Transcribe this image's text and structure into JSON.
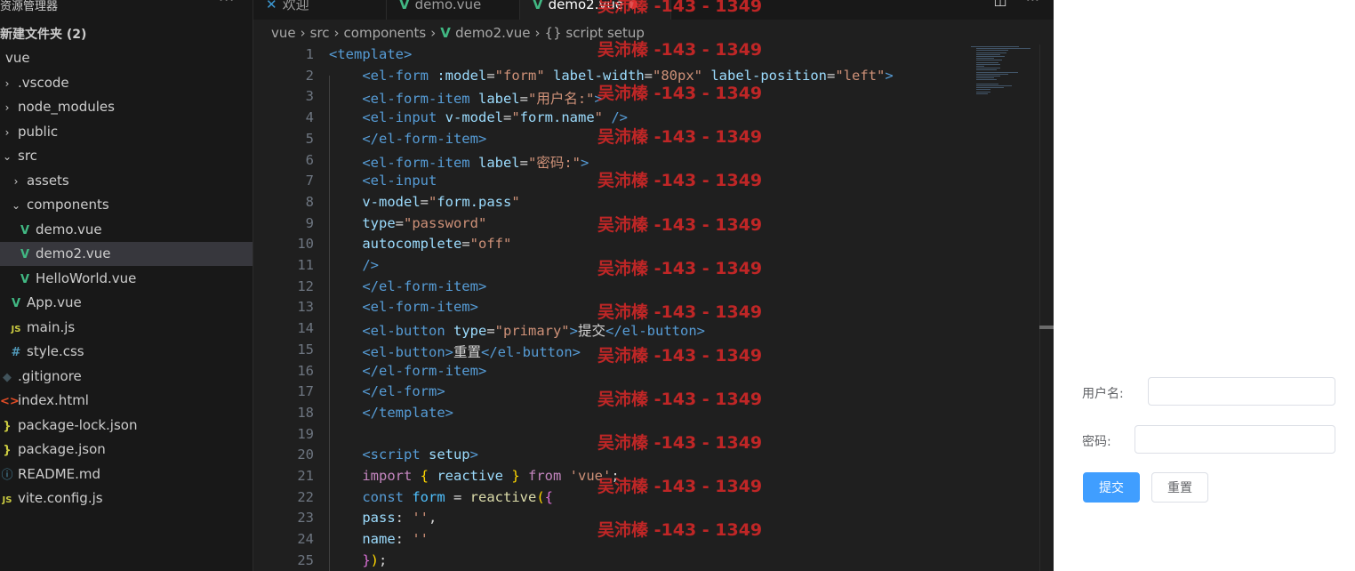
{
  "sidebar": {
    "header_title": "资源管理器",
    "header_more": "···",
    "folder_title": "新建文件夹 (2)",
    "items": [
      {
        "label": "vue",
        "icon": "none",
        "indent": 0
      },
      {
        "label": ".vscode",
        "icon": "chevron-right",
        "indent": 1
      },
      {
        "label": "node_modules",
        "icon": "chevron-right",
        "indent": 1
      },
      {
        "label": "public",
        "icon": "chevron-right",
        "indent": 1
      },
      {
        "label": "src",
        "icon": "chevron-down",
        "indent": 1
      },
      {
        "label": "assets",
        "icon": "chevron-right",
        "indent": 2
      },
      {
        "label": "components",
        "icon": "chevron-down",
        "indent": 2
      },
      {
        "label": "demo.vue",
        "icon": "vue",
        "indent": 3
      },
      {
        "label": "demo2.vue",
        "icon": "vue",
        "indent": 3,
        "selected": true
      },
      {
        "label": "HelloWorld.vue",
        "icon": "vue",
        "indent": 3
      },
      {
        "label": "App.vue",
        "icon": "vue",
        "indent": 2
      },
      {
        "label": "main.js",
        "icon": "js",
        "indent": 2
      },
      {
        "label": "style.css",
        "icon": "css",
        "indent": 2
      },
      {
        "label": ".gitignore",
        "icon": "git",
        "indent": 1
      },
      {
        "label": "index.html",
        "icon": "html",
        "indent": 1
      },
      {
        "label": "package-lock.json",
        "icon": "json",
        "indent": 1
      },
      {
        "label": "package.json",
        "icon": "json",
        "indent": 1
      },
      {
        "label": "README.md",
        "icon": "info",
        "indent": 1
      },
      {
        "label": "vite.config.js",
        "icon": "js",
        "indent": 1
      }
    ]
  },
  "tabs": [
    {
      "label": "欢迎",
      "icon": "vscode"
    },
    {
      "label": "demo.vue",
      "icon": "vue"
    },
    {
      "label": "demo2.vue",
      "icon": "vue",
      "active": true,
      "modified": true
    }
  ],
  "tab_actions": [
    "split-editor",
    "more"
  ],
  "breadcrumb": [
    "vue",
    "src",
    "components",
    "demo2.vue",
    "{} script setup"
  ],
  "code_lines": [
    [
      [
        "tag",
        "<template>"
      ]
    ],
    [
      [
        "tag",
        "    <el-form "
      ],
      [
        "attr",
        ":model"
      ],
      [
        "txt",
        "="
      ],
      [
        "str",
        "\"form\""
      ],
      [
        "attr",
        " label-width"
      ],
      [
        "txt",
        "="
      ],
      [
        "str",
        "\"80px\""
      ],
      [
        "attr",
        " label-position"
      ],
      [
        "txt",
        "="
      ],
      [
        "str",
        "\"left\""
      ],
      [
        "tag",
        ">"
      ]
    ],
    [
      [
        "tag",
        "    <el-form-item "
      ],
      [
        "attr",
        "label"
      ],
      [
        "txt",
        "="
      ],
      [
        "str",
        "\"用户名:\""
      ],
      [
        "tag",
        ">"
      ]
    ],
    [
      [
        "tag",
        "    <el-input "
      ],
      [
        "attr",
        "v-model"
      ],
      [
        "txt",
        "="
      ],
      [
        "str",
        "\""
      ],
      [
        "id",
        "form.name"
      ],
      [
        "str",
        "\""
      ],
      [
        "tag",
        " />"
      ]
    ],
    [
      [
        "tag",
        "    </el-form-item>"
      ]
    ],
    [
      [
        "tag",
        "    <el-form-item "
      ],
      [
        "attr",
        "label"
      ],
      [
        "txt",
        "="
      ],
      [
        "str",
        "\"密码:\""
      ],
      [
        "tag",
        ">"
      ]
    ],
    [
      [
        "tag",
        "    <el-input"
      ]
    ],
    [
      [
        "attr",
        "    v-model"
      ],
      [
        "txt",
        "="
      ],
      [
        "str",
        "\""
      ],
      [
        "id",
        "form.pass"
      ],
      [
        "str",
        "\""
      ]
    ],
    [
      [
        "attr",
        "    type"
      ],
      [
        "txt",
        "="
      ],
      [
        "str",
        "\"password\""
      ]
    ],
    [
      [
        "attr",
        "    autocomplete"
      ],
      [
        "txt",
        "="
      ],
      [
        "str",
        "\"off\""
      ]
    ],
    [
      [
        "tag",
        "    />"
      ]
    ],
    [
      [
        "tag",
        "    </el-form-item>"
      ]
    ],
    [
      [
        "tag",
        "    <el-form-item>"
      ]
    ],
    [
      [
        "tag",
        "    <el-button "
      ],
      [
        "attr",
        "type"
      ],
      [
        "txt",
        "="
      ],
      [
        "str",
        "\"primary\""
      ],
      [
        "tag",
        ">"
      ],
      [
        "txt",
        "提交"
      ],
      [
        "tag",
        "</el-button>"
      ]
    ],
    [
      [
        "tag",
        "    <el-button>"
      ],
      [
        "txt",
        "重置"
      ],
      [
        "tag",
        "</el-button>"
      ]
    ],
    [
      [
        "tag",
        "    </el-form-item>"
      ]
    ],
    [
      [
        "tag",
        "    </el-form>"
      ]
    ],
    [
      [
        "tag",
        "    </template>"
      ]
    ],
    [],
    [
      [
        "tag",
        "    <script "
      ],
      [
        "attr",
        "setup"
      ],
      [
        "tag",
        ">"
      ]
    ],
    [
      [
        "kw",
        "    import "
      ],
      [
        "br",
        "{ "
      ],
      [
        "id",
        "reactive"
      ],
      [
        "br",
        " }"
      ],
      [
        "kw",
        " from "
      ],
      [
        "str",
        "'vue'"
      ],
      [
        "txt",
        ";"
      ]
    ],
    [
      [
        "dec",
        "    const "
      ],
      [
        "var",
        "form"
      ],
      [
        "txt",
        " = "
      ],
      [
        "fn",
        "reactive"
      ],
      [
        "br",
        "("
      ],
      [
        "br2",
        "{"
      ]
    ],
    [
      [
        "id",
        "    pass"
      ],
      [
        "txt",
        ": "
      ],
      [
        "str",
        "''"
      ],
      [
        "txt",
        ","
      ]
    ],
    [
      [
        "id",
        "    name"
      ],
      [
        "txt",
        ": "
      ],
      [
        "str",
        "''"
      ]
    ],
    [
      [
        "br2",
        "    }"
      ],
      [
        "br",
        ")"
      ],
      [
        "txt",
        ";"
      ]
    ]
  ],
  "watermark": "吴沛榛 -143 - 1349",
  "preview": {
    "username_label": "用户名:",
    "password_label": "密码:",
    "submit_label": "提交",
    "reset_label": "重置"
  },
  "colors": {
    "primary": "#409eff",
    "vue_green": "#41b883",
    "editor_bg": "#1f1f1f",
    "watermark": "#dc2828"
  }
}
